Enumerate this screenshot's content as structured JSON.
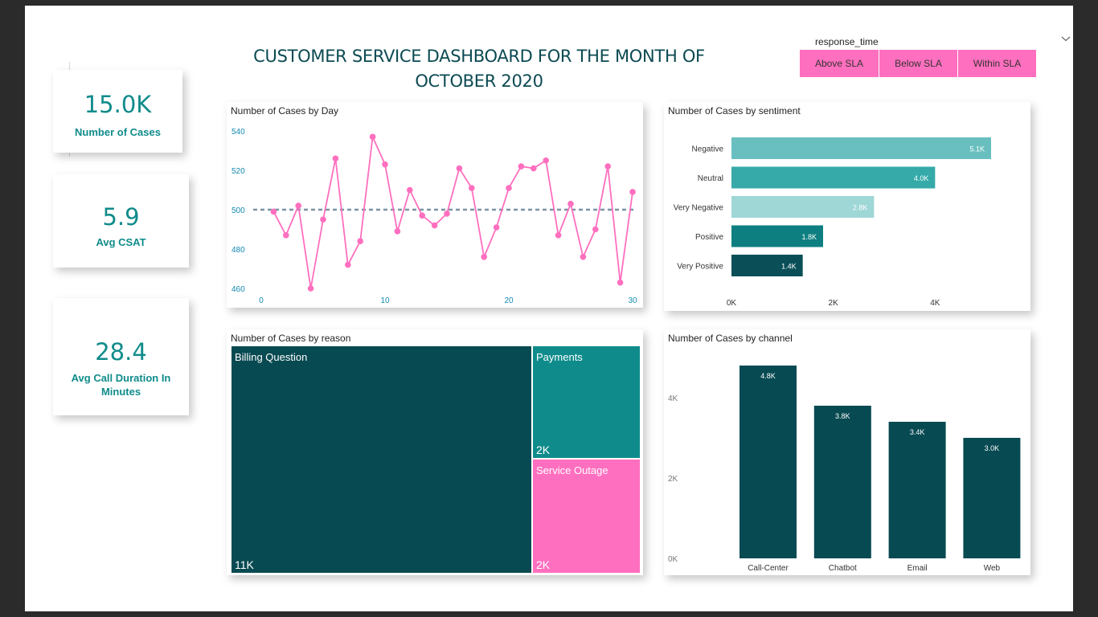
{
  "dashboard": {
    "title_line1": "CUSTOMER SERVICE DASHBOARD FOR THE MONTH OF",
    "title_line2": "OCTOBER 2020"
  },
  "slicer": {
    "label": "response_time",
    "options": [
      "Above SLA",
      "Below SLA",
      "Within SLA"
    ]
  },
  "kpis": [
    {
      "value": "15.0K",
      "label": "Number of Cases"
    },
    {
      "value": "5.9",
      "label": "Avg CSAT"
    },
    {
      "value": "28.4",
      "label_line1": "Avg Call Duration In",
      "label_line2": "Minutes"
    }
  ],
  "colors": {
    "pink": "#ff6fbf",
    "teal_dark": "#084a52",
    "teal": "#0f8b8b",
    "kpi_text": "#108b8b"
  },
  "chart_data": [
    {
      "title": "Number of Cases by Day",
      "type": "line",
      "x": [
        1,
        2,
        3,
        4,
        5,
        6,
        7,
        8,
        9,
        10,
        11,
        12,
        13,
        14,
        15,
        16,
        17,
        18,
        19,
        20,
        21,
        22,
        23,
        24,
        25,
        26,
        27,
        28,
        29,
        30
      ],
      "values": [
        499,
        487,
        502,
        460,
        495,
        526,
        472,
        484,
        537,
        523,
        489,
        510,
        497,
        492,
        498,
        521,
        511,
        476,
        491,
        511,
        522,
        521,
        525,
        487,
        503,
        476,
        490,
        522,
        463,
        509
      ],
      "y_ticks": [
        "540",
        "520",
        "500",
        "480",
        "460"
      ],
      "x_ticks": [
        "0",
        "10",
        "20",
        "30"
      ],
      "ylim": [
        460,
        540
      ],
      "xlim": [
        0,
        30
      ],
      "reference_line": 500,
      "grid": false
    },
    {
      "title": "Number of Cases by sentiment",
      "type": "bar",
      "orientation": "horizontal",
      "categories": [
        "Negative",
        "Neutral",
        "Very Negative",
        "Positive",
        "Very Positive"
      ],
      "values": [
        5100,
        4000,
        2800,
        1800,
        1400
      ],
      "data_labels": [
        "5.1K",
        "4.0K",
        "2.8K",
        "1.8K",
        "1.4K"
      ],
      "bar_colors": [
        "#69bfbf",
        "#35aaa9",
        "#9fd6d6",
        "#0e7f80",
        "#0a4f57"
      ],
      "x_ticks": [
        "0K",
        "2K",
        "4K"
      ],
      "xlim": [
        0,
        5400
      ]
    },
    {
      "title": "Number of Cases by reason",
      "type": "treemap",
      "items": [
        {
          "name": "Billing Question",
          "value": 11000,
          "label": "11K",
          "color": "#084a52"
        },
        {
          "name": "Payments",
          "value": 2000,
          "label": "2K",
          "color": "#0f8b8b"
        },
        {
          "name": "Service Outage",
          "value": 2000,
          "label": "2K",
          "color": "#ff6fbf"
        }
      ]
    },
    {
      "title": "Number of Cases by channel",
      "type": "bar",
      "orientation": "vertical",
      "categories": [
        "Call-Center",
        "Chatbot",
        "Email",
        "Web"
      ],
      "values": [
        4800,
        3800,
        3400,
        3000
      ],
      "data_labels": [
        "4.8K",
        "3.8K",
        "3.4K",
        "3.0K"
      ],
      "y_ticks": [
        "4K",
        "2K",
        "0K"
      ],
      "ylim": [
        0,
        5000
      ]
    }
  ]
}
